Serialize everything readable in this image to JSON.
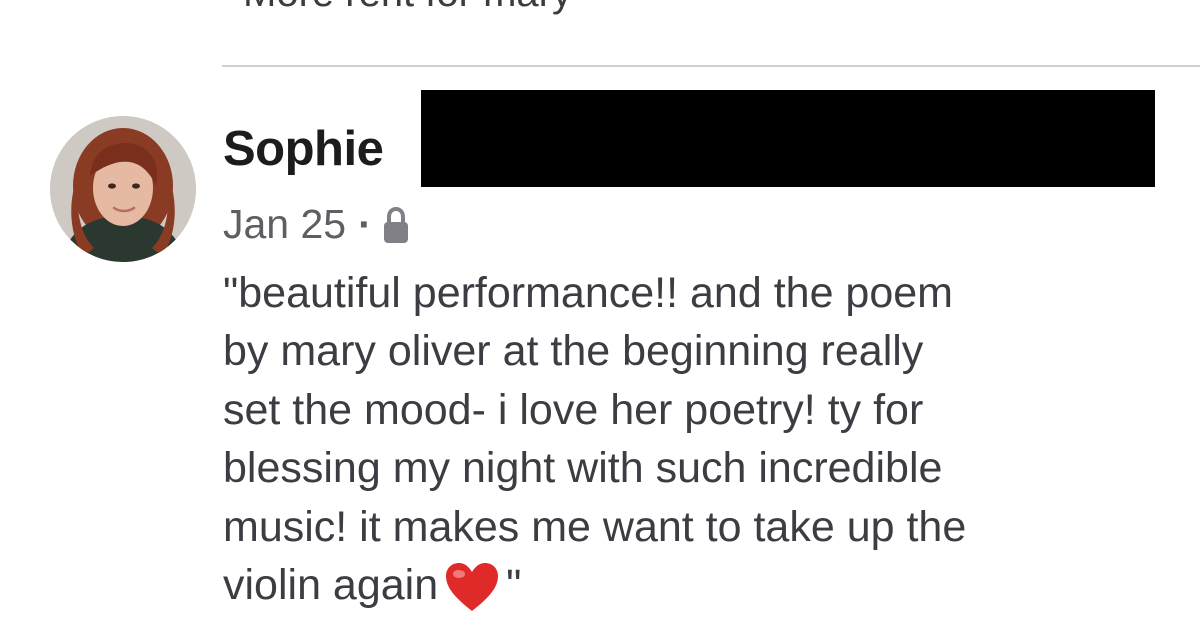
{
  "previous_post": {
    "cut_off_text": "More rent for mary"
  },
  "comment": {
    "author_name": "Sophie",
    "date": "Jan 25",
    "separator": "·",
    "visibility_icon": "lock-icon",
    "reaction_icon": "red-heart-icon",
    "lines": [
      "\"beautiful performance!! and the poem",
      "by mary oliver at the beginning really",
      "set the mood- i love her poetry! ty for",
      "blessing my night with such incredible",
      "music! it makes me want to take up the",
      "violin again"
    ],
    "closing_quote": "\""
  },
  "colors": {
    "text_primary": "#1c1c1e",
    "text_body": "#3c3c43",
    "text_meta": "#5f5f63",
    "divider": "#cfcfd2",
    "redaction": "#000000",
    "heart": "#e02a2a"
  }
}
